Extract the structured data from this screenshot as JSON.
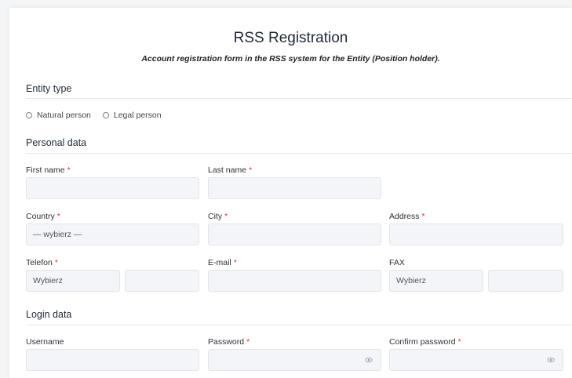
{
  "header": {
    "title": "RSS Registration",
    "subtitle": "Account registration form in the RSS system for the Entity (Position holder)."
  },
  "entity_type": {
    "heading": "Entity type",
    "options": [
      "Natural person",
      "Legal person"
    ]
  },
  "personal": {
    "heading": "Personal data",
    "first_name_label": "First name",
    "last_name_label": "Last name",
    "country_label": "Country",
    "country_value": "— wybierz —",
    "city_label": "City",
    "address_label": "Address",
    "telefon_label": "Telefon",
    "telefon_prefix": "Wybierz",
    "email_label": "E-mail",
    "fax_label": "FAX",
    "fax_prefix": "Wybierz"
  },
  "login": {
    "heading": "Login data",
    "username_label": "Username",
    "password_label": "Password",
    "confirm_label": "Confirm password"
  },
  "required_mark": "*",
  "colors": {
    "required": "#e03131",
    "field_bg": "#f3f5f8",
    "field_border": "#e2e5e9"
  }
}
